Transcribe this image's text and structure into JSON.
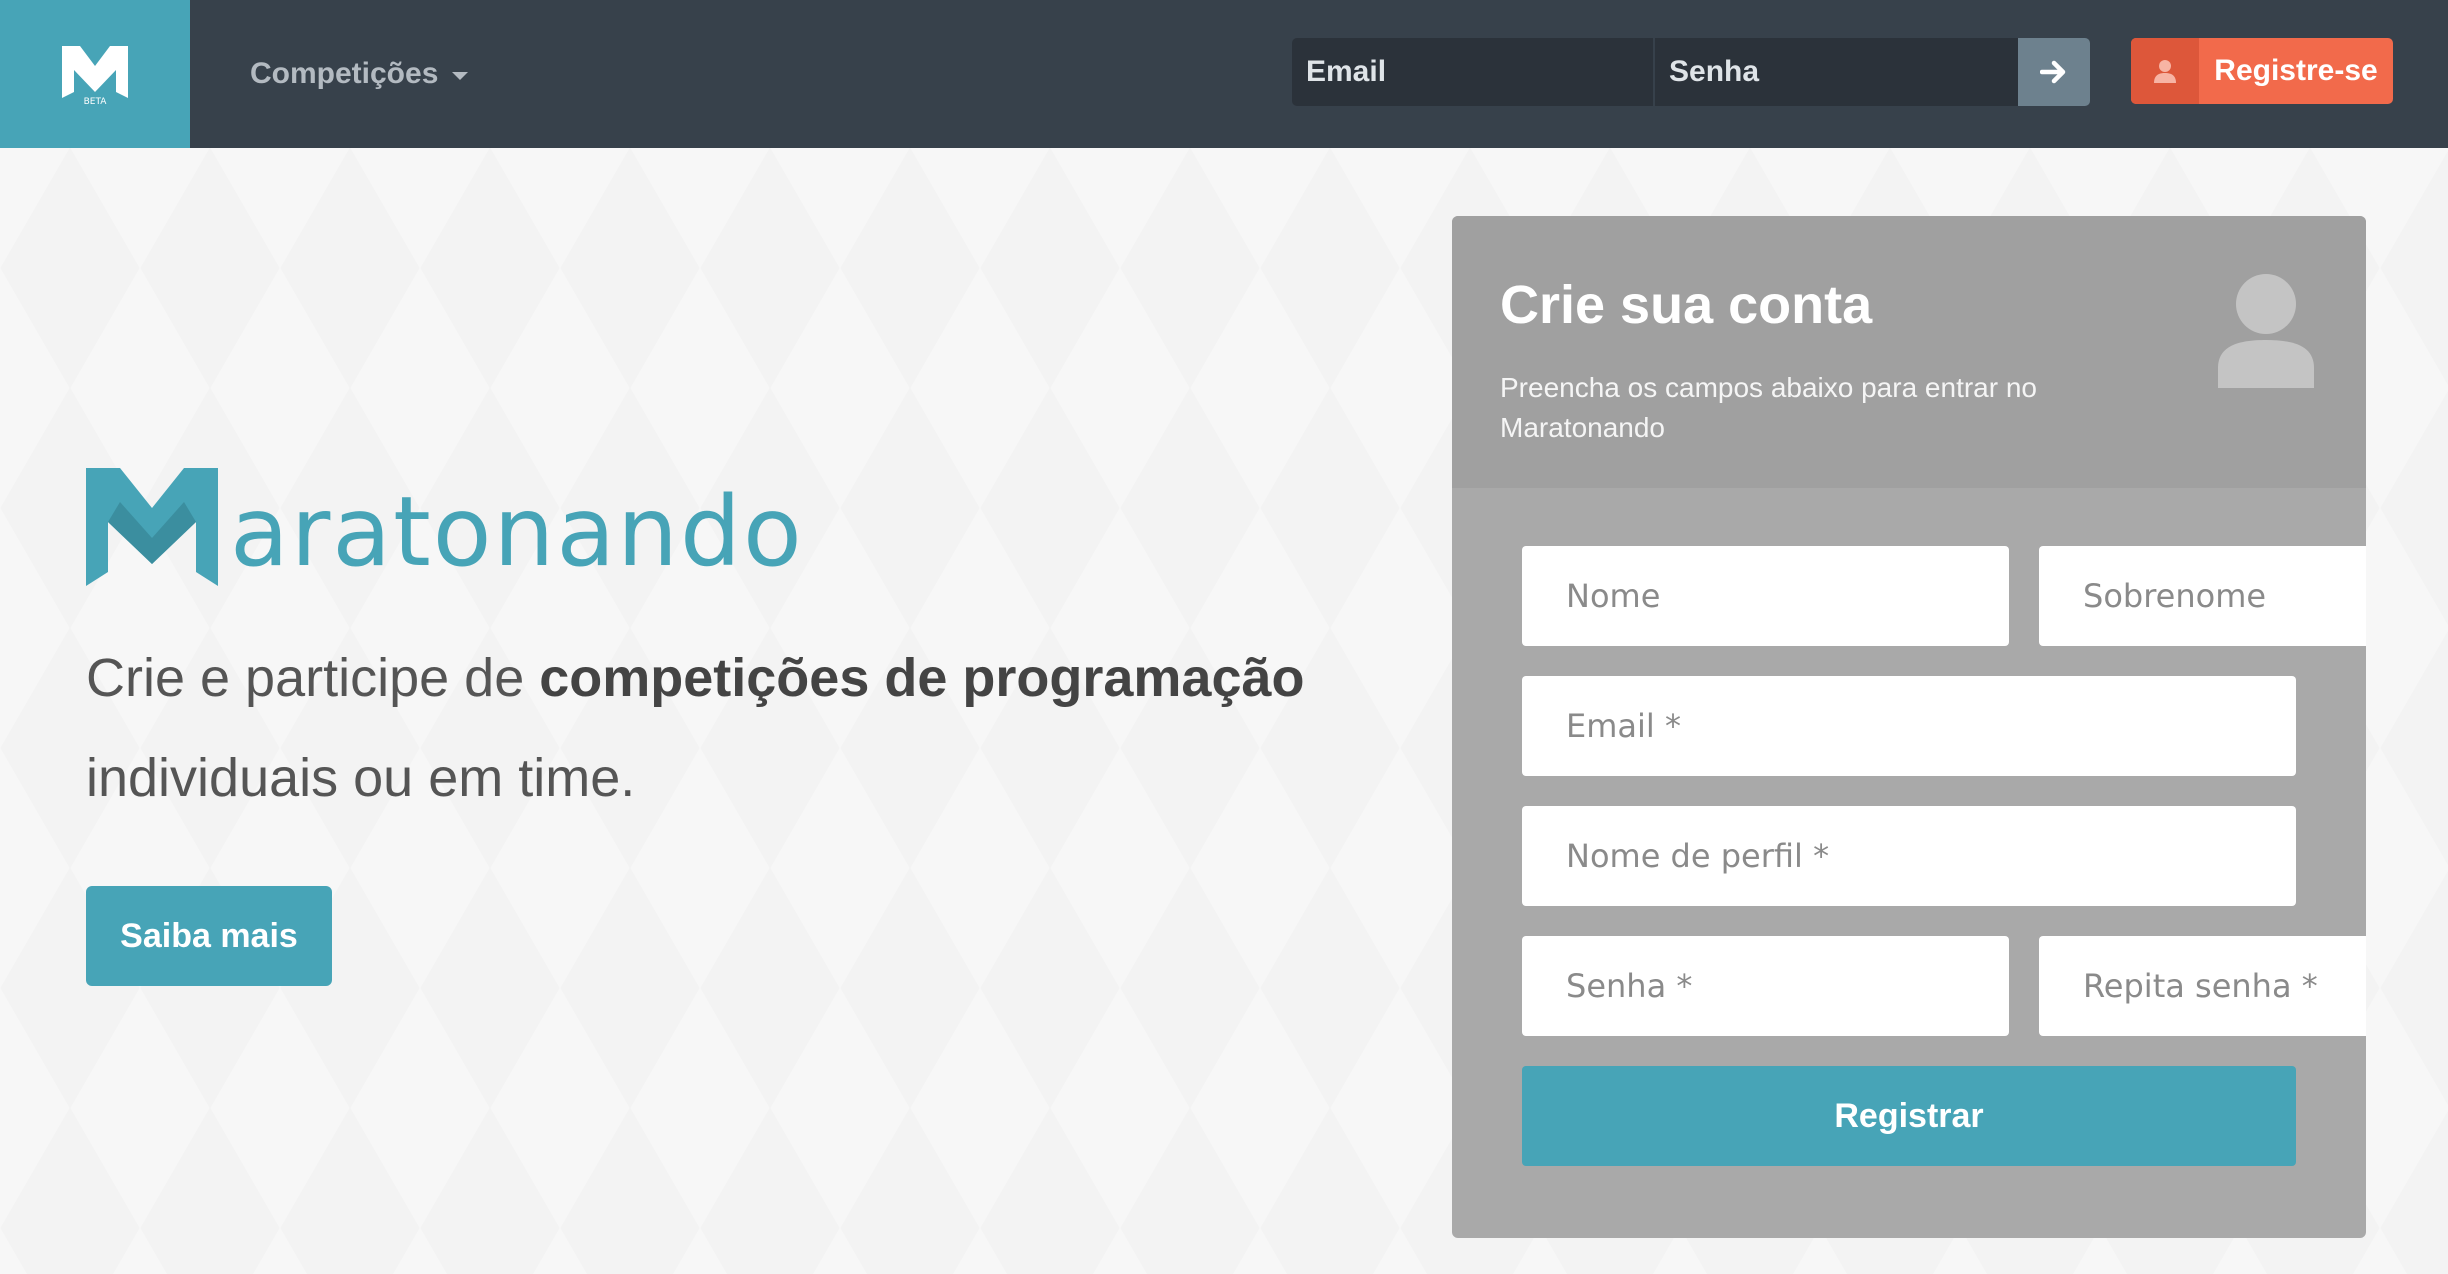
{
  "colors": {
    "navbar_bg": "#37414b",
    "brand_bg": "#47a4b7",
    "accent": "#47a4b7",
    "register_button": "#f26a4b",
    "card_bg": "#a9a9a9"
  },
  "navbar": {
    "brand_badge": "BETA",
    "competitions_label": "Competições",
    "login": {
      "email_placeholder": "Email",
      "password_placeholder": "Senha",
      "submit_icon": "arrow-right-icon"
    },
    "register_label": "Registre-se",
    "register_icon": "user-icon"
  },
  "hero": {
    "logo_text": "aratonando",
    "tagline_part1": "Crie e participe de ",
    "tagline_bold": "competições de programação",
    "tagline_part2": "individuais ou em time.",
    "learn_more_label": "Saiba mais"
  },
  "signup": {
    "title": "Crie sua conta",
    "subtitle": "Preencha os campos abaixo para entrar no Maratonando",
    "header_icon": "user-silhouette-icon",
    "fields": {
      "first_name": "Nome",
      "last_name": "Sobrenome",
      "email": "Email *",
      "username": "Nome de perfil *",
      "password": "Senha *",
      "repeat_password": "Repita senha *"
    },
    "submit_label": "Registrar"
  }
}
